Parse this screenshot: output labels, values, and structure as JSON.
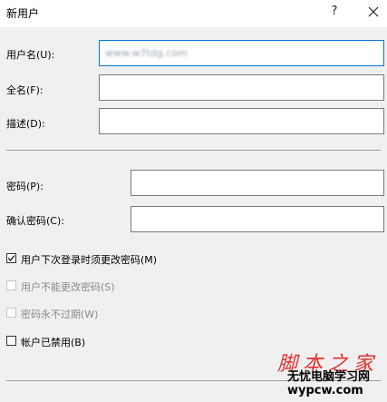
{
  "window": {
    "title": "新用户",
    "help_glyph": "?"
  },
  "form": {
    "username_label": "用户名(U):",
    "username_value": "www.w7tdg.com",
    "fullname_label": "全名(F):",
    "fullname_value": "",
    "description_label": "描述(D):",
    "description_value": "",
    "password_label": "密码(P):",
    "password_value": "",
    "confirm_label": "确认密码(C):",
    "confirm_value": ""
  },
  "options": [
    {
      "label": "用户下次登录时须更改密码(M)",
      "checked": true,
      "enabled": true
    },
    {
      "label": "用户不能更改密码(S)",
      "checked": false,
      "enabled": false
    },
    {
      "label": "密码永不过期(W)",
      "checked": false,
      "enabled": false
    },
    {
      "label": "帐户已禁用(B)",
      "checked": false,
      "enabled": true
    }
  ],
  "watermark": {
    "site_art": "脚本之家",
    "site_cn": "无忧电脑学习网",
    "site_url": "wypcw.com"
  },
  "colors": {
    "focus_border": "#0078d7",
    "dialog_bg": "#f0f0f0",
    "watermark_red": "#e23030"
  }
}
